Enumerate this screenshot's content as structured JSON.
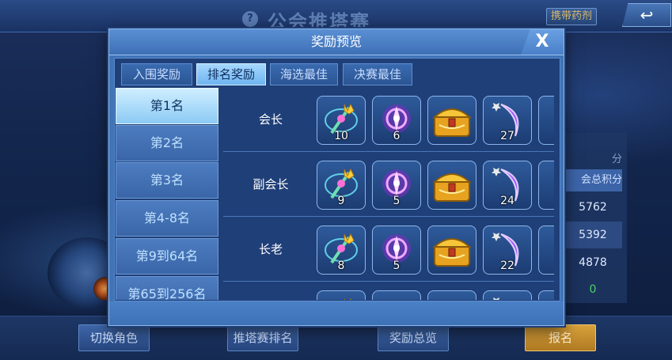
{
  "background": {
    "title": "公会推塔赛",
    "help_icon": "help-icon",
    "potion_button": "携带药剂",
    "back_icon": "back-arrow-icon",
    "score_header": "分",
    "score_column": "会总积分",
    "scores": [
      "5762",
      "5392",
      "4878",
      "0"
    ]
  },
  "bottom_bar": {
    "switch_role": "切换角色",
    "tower_ranking": "推塔赛排名",
    "reward_overview": "奖励总览",
    "sign_up": "报名"
  },
  "modal": {
    "title": "奖励预览",
    "close_label": "X",
    "tabs": [
      {
        "label": "入围奖励",
        "active": false
      },
      {
        "label": "排名奖励",
        "active": true
      },
      {
        "label": "海选最佳",
        "active": false
      },
      {
        "label": "决赛最佳",
        "active": false
      }
    ],
    "ranks": [
      {
        "label": "第1名",
        "active": true
      },
      {
        "label": "第2名",
        "active": false
      },
      {
        "label": "第3名",
        "active": false
      },
      {
        "label": "第4-8名",
        "active": false
      },
      {
        "label": "第9到64名",
        "active": false
      },
      {
        "label": "第65到256名",
        "active": false
      }
    ],
    "reward_rows": [
      {
        "role": "会长",
        "items": [
          {
            "icon": "crown-staff-icon",
            "count": "10"
          },
          {
            "icon": "purple-gem-icon",
            "count": "6"
          },
          {
            "icon": "gold-chest-icon",
            "count": ""
          },
          {
            "icon": "crescent-scroll-icon",
            "count": "27"
          }
        ]
      },
      {
        "role": "副会长",
        "items": [
          {
            "icon": "crown-staff-icon",
            "count": "9"
          },
          {
            "icon": "purple-gem-icon",
            "count": "5"
          },
          {
            "icon": "gold-chest-icon",
            "count": ""
          },
          {
            "icon": "crescent-scroll-icon",
            "count": "24"
          }
        ]
      },
      {
        "role": "长老",
        "items": [
          {
            "icon": "crown-staff-icon",
            "count": "8"
          },
          {
            "icon": "purple-gem-icon",
            "count": "5"
          },
          {
            "icon": "gold-chest-icon",
            "count": ""
          },
          {
            "icon": "crescent-scroll-icon",
            "count": "22"
          }
        ]
      },
      {
        "role": "",
        "items": [
          {
            "icon": "crown-staff-icon",
            "count": ""
          },
          {
            "icon": "purple-gem-icon",
            "count": ""
          },
          {
            "icon": "gold-chest-icon",
            "count": ""
          },
          {
            "icon": "crescent-scroll-icon",
            "count": ""
          }
        ]
      }
    ]
  }
}
